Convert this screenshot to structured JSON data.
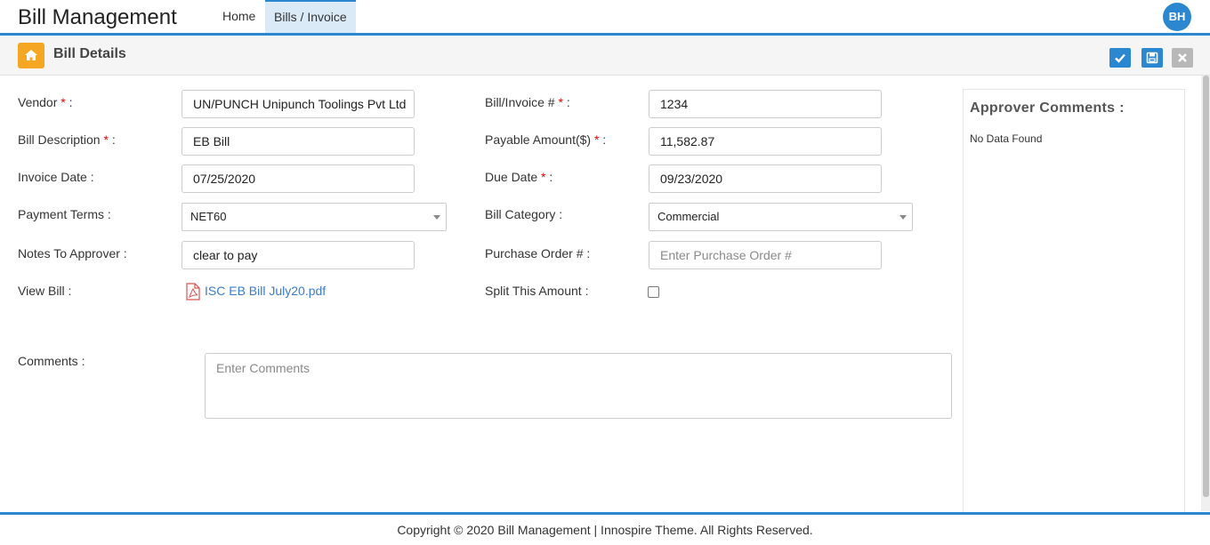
{
  "app": {
    "title": "Bill Management",
    "nav": [
      "Home",
      "Bills / Invoice"
    ],
    "user_initials": "BH"
  },
  "page": {
    "title": "Bill Details",
    "actions": [
      "approve-icon",
      "save-icon",
      "cancel-icon"
    ]
  },
  "form": {
    "vendor": {
      "label": "Vendor",
      "required": "*",
      "value": "UN/PUNCH Unipunch Toolings Pvt Ltd"
    },
    "bill_description": {
      "label": "Bill Description",
      "required": "*",
      "value": "EB Bill"
    },
    "invoice_date": {
      "label": "Invoice Date :",
      "value": "07/25/2020"
    },
    "payment_terms": {
      "label": "Payment Terms :",
      "value": "NET60"
    },
    "notes_to_approver": {
      "label": "Notes To Approver :",
      "value": "clear to pay"
    },
    "view_bill": {
      "label": "View Bill :",
      "file": "ISC EB Bill July20.pdf"
    },
    "bill_invoice_no": {
      "label": "Bill/Invoice #",
      "required": "*",
      "value": "1234"
    },
    "payable_amount": {
      "label": "Payable Amount($)",
      "required": "*",
      "value": "11,582.87"
    },
    "due_date": {
      "label": "Due Date",
      "required": "*",
      "value": "09/23/2020"
    },
    "bill_category": {
      "label": "Bill Category :",
      "value": "Commercial"
    },
    "purchase_order": {
      "label": "Purchase Order # :",
      "placeholder": "Enter Purchase Order #"
    },
    "split_amount": {
      "label": "Split This Amount :",
      "checked": false
    },
    "comments": {
      "label": "Comments :",
      "placeholder": "Enter Comments"
    }
  },
  "approver": {
    "title": "Approver Comments :",
    "empty": "No Data Found"
  },
  "footer": {
    "text": "Copyright © 2020 Bill Management | Innospire Theme. All Rights Reserved."
  },
  "colors": {
    "accent": "#2a87d0",
    "home_badge": "#f5a623",
    "required": "#e00000",
    "link": "#3a7bc8"
  }
}
